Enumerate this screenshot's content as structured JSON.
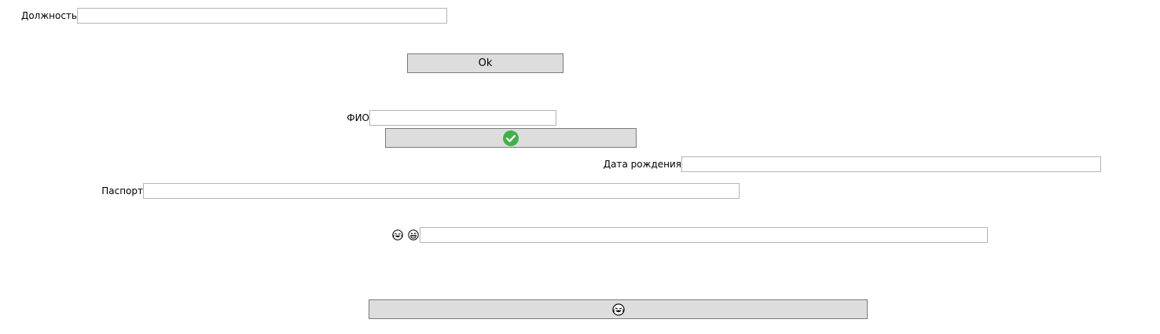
{
  "form": {
    "position_label": "Должность",
    "position_value": "",
    "ok_button_label": "Ok",
    "fio_label": "ФИО",
    "fio_value": "",
    "confirm_icon": "check-circle-icon",
    "birth_date_label": "Дата рождения",
    "birth_date_value": "",
    "passport_label": "Паспорт",
    "passport_value": "",
    "emoji_icons": [
      "laughing-tears-face-icon",
      "grinning-face-icon"
    ],
    "emoji_field_value": "",
    "bottom_button_icon": "laughing-tears-face-icon"
  },
  "colors": {
    "button_bg": "#dddddd",
    "button_border": "#7a7a7a",
    "field_border": "#b4b4b4",
    "check_green": "#43b04a"
  }
}
